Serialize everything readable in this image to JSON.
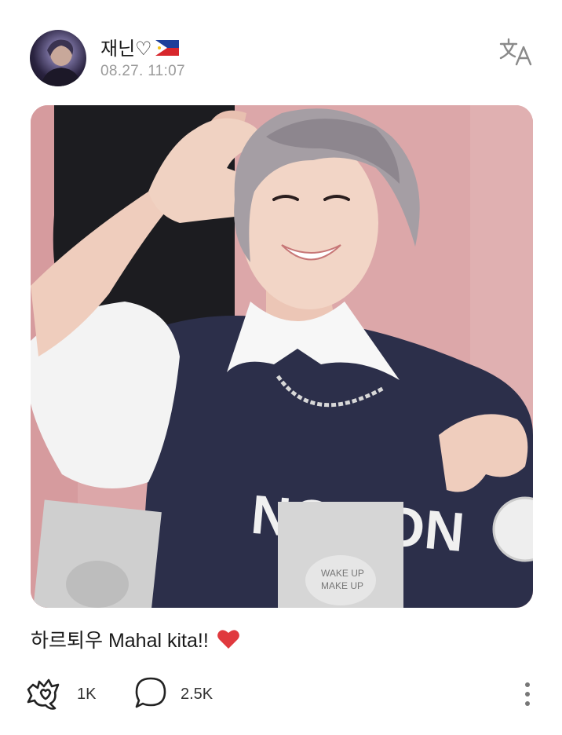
{
  "post": {
    "author_name": "재닌♡",
    "author_flag_icon": "philippines-flag-icon",
    "timestamp": "08.27. 11:07",
    "translate_icon": "translate-icon",
    "caption_text": "하르퇴우 Mahal kita!!",
    "caption_emoji_icon": "red-heart-icon",
    "image_icon": "photo-of-person-making-heart-gesture"
  },
  "actions": {
    "likes_icon": "cheer-heart-icon",
    "likes_count": "1K",
    "comments_icon": "comment-bubble-icon",
    "comments_count": "2.5K",
    "more_icon": "more-vertical-icon"
  },
  "colors": {
    "photo_background": "#dca7a9",
    "sweater": "#2c2f4a",
    "heart": "#e0393e",
    "timestamp": "#9a9a9a"
  }
}
